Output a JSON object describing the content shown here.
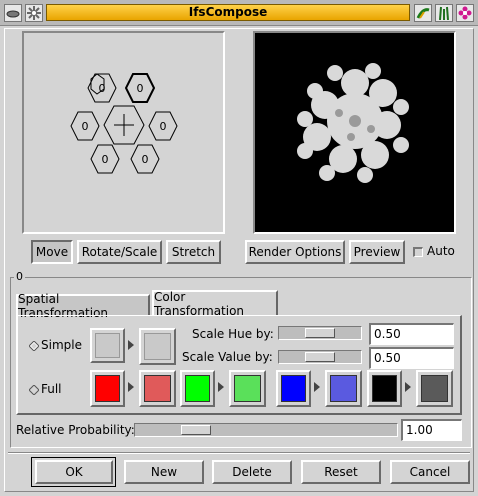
{
  "window": {
    "title": "IfsCompose",
    "icons": [
      "menu-icon",
      "sparkle-icon",
      "plant-icon",
      "grass-icon",
      "flower-icon"
    ]
  },
  "design": {
    "hexagons": [
      {
        "label": "0",
        "selected": false
      },
      {
        "label": "0",
        "selected": true
      },
      {
        "label": "0",
        "selected": false
      },
      {
        "label": "",
        "selected": false
      },
      {
        "label": "0",
        "selected": false
      },
      {
        "label": "0",
        "selected": false
      },
      {
        "label": "0",
        "selected": false
      }
    ]
  },
  "mode_buttons": {
    "move": "Move",
    "rotate_scale": "Rotate/Scale",
    "stretch": "Stretch",
    "active": "Move"
  },
  "preview_buttons": {
    "render_options": "Render Options",
    "preview": "Preview",
    "auto": "Auto",
    "auto_checked": false
  },
  "transform_frame": {
    "label": "0",
    "tabs": [
      "Spatial Transformation",
      "Color Transformation"
    ],
    "active_tab": "Color Transformation",
    "simple_label": "Simple",
    "full_label": "Full",
    "simple_selected": true,
    "scale_hue_label": "Scale Hue by:",
    "scale_hue_value": "0.50",
    "scale_value_label": "Scale Value by:",
    "scale_value_value": "0.50",
    "scale_hue_level": 0.5,
    "scale_value_level": 0.5
  },
  "colors": {
    "simple_target": "#c9c9c9",
    "simple_result": "#c9c9c9",
    "red": "#ff0000",
    "red_result": "#e05a5a",
    "green": "#00ff00",
    "green_result": "#5ae05a",
    "blue": "#0000ff",
    "blue_result": "#5a5ae0",
    "black": "#000000",
    "black_result": "#5a5a5a"
  },
  "probability": {
    "label": "Relative Probability:",
    "value": "1.00",
    "level": 0.2
  },
  "dialog_buttons": {
    "ok": "OK",
    "new": "New",
    "delete": "Delete",
    "reset": "Reset",
    "cancel": "Cancel"
  }
}
